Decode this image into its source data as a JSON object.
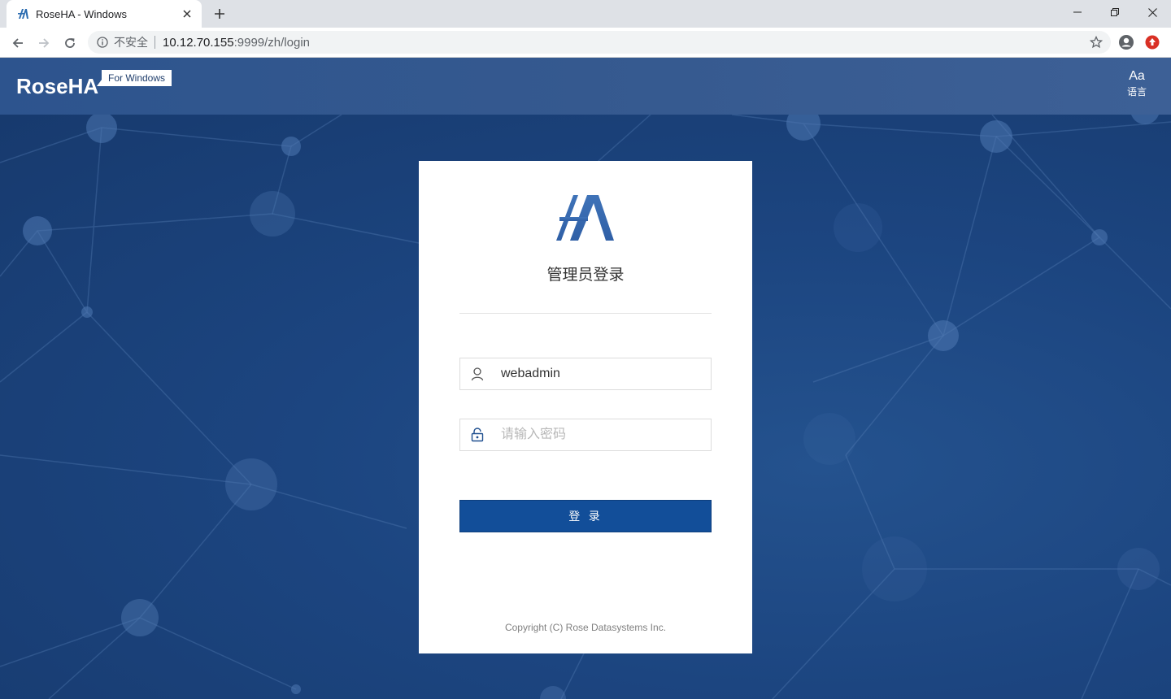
{
  "browser": {
    "tab_title": "RoseHA - Windows",
    "new_tab_label": "+",
    "address": {
      "security_label": "不安全",
      "host": "10.12.70.155",
      "path": ":9999/zh/login"
    }
  },
  "header": {
    "brand": "RoseHA",
    "brand_tag": "For Windows",
    "language_icon_text": "Aa",
    "language_label": "语言"
  },
  "login": {
    "title": "管理员登录",
    "username_value": "webadmin",
    "password_placeholder": "请输入密码",
    "submit_label": "登 录",
    "copyright": "Copyright (C) Rose Datasystems Inc."
  },
  "colors": {
    "header_bg": "#35598f",
    "page_bg": "#1c4580",
    "primary_button": "#124e99",
    "logo_blue": "#3f73b8"
  }
}
